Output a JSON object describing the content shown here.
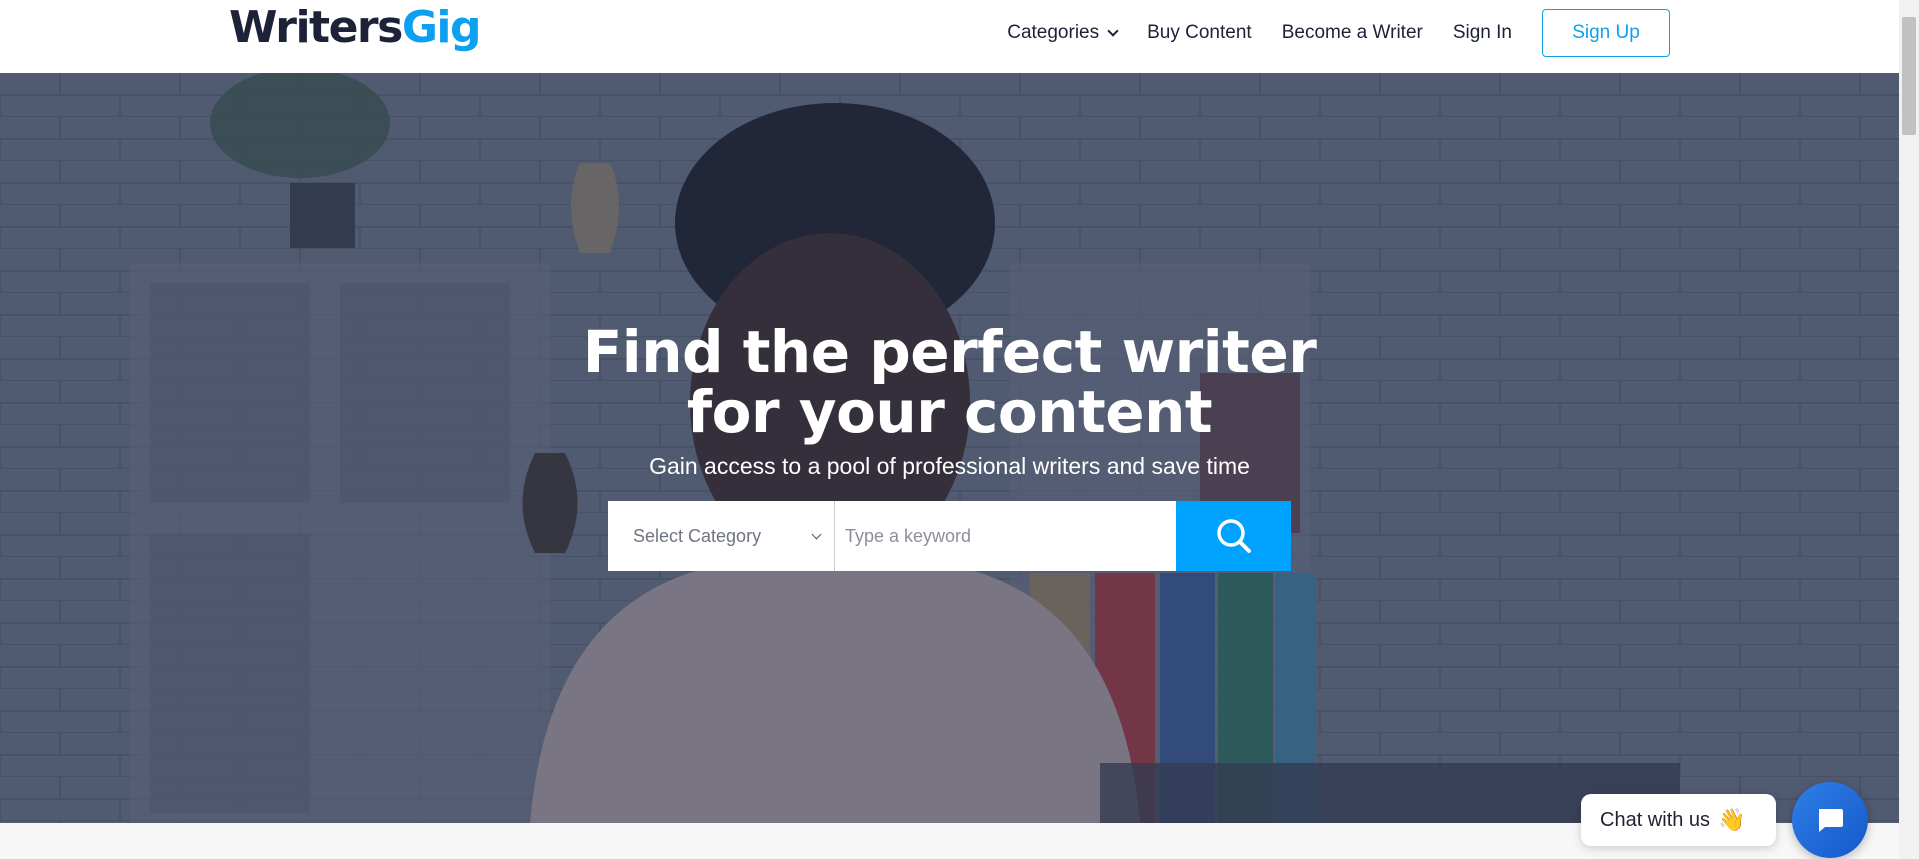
{
  "logo": {
    "part1": "Writers",
    "part2": "Gig"
  },
  "nav": {
    "categories": "Categories",
    "buy_content": "Buy Content",
    "become_writer": "Become a Writer",
    "sign_in": "Sign In",
    "sign_up": "Sign Up"
  },
  "hero": {
    "title_line1": "Find the perfect writer",
    "title_line2": "for your content",
    "subtitle": "Gain access to a pool of professional writers and save time"
  },
  "search": {
    "category_selected": "Select Category",
    "keyword_placeholder": "Type a keyword"
  },
  "chat": {
    "label": "Chat with us",
    "emoji": "👋"
  },
  "colors": {
    "brand_dark": "#1c2238",
    "brand_blue": "#0ea0f0",
    "search_button": "#00a2ff",
    "chat_button": "#1a63d6"
  },
  "icons": [
    "chevron-down-icon",
    "search-icon",
    "chat-icon",
    "wave-icon"
  ]
}
